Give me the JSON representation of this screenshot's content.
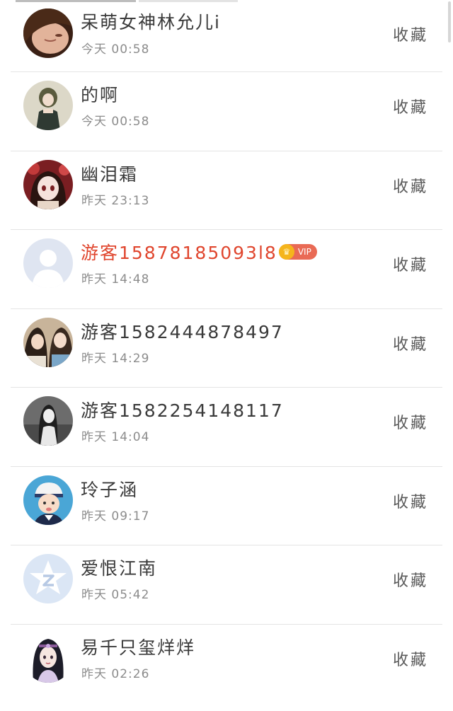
{
  "users": [
    {
      "name": "呆萌女神林允儿i",
      "time": "今天 00:58",
      "vip": false,
      "action": "收藏",
      "avatar_icon": "user-photo-avatar-icon"
    },
    {
      "name": "的啊",
      "time": "今天 00:58",
      "vip": false,
      "action": "收藏",
      "avatar_icon": "user-photo-avatar-icon"
    },
    {
      "name": "幽泪霜",
      "time": "昨天 23:13",
      "vip": false,
      "action": "收藏",
      "avatar_icon": "user-photo-avatar-icon"
    },
    {
      "name": "游客15878185093l8",
      "time": "昨天 14:48",
      "vip": true,
      "vip_label": "VIP",
      "action": "收藏",
      "avatar_icon": "default-user-avatar-icon"
    },
    {
      "name": "游客1582444878497",
      "time": "昨天 14:29",
      "vip": false,
      "action": "收藏",
      "avatar_icon": "user-photo-avatar-icon"
    },
    {
      "name": "游客1582254148117",
      "time": "昨天 14:04",
      "vip": false,
      "action": "收藏",
      "avatar_icon": "user-photo-avatar-icon"
    },
    {
      "name": "玲子涵",
      "time": "昨天 09:17",
      "vip": false,
      "action": "收藏",
      "avatar_icon": "user-photo-avatar-icon"
    },
    {
      "name": "爱恨江南",
      "time": "昨天 05:42",
      "vip": false,
      "action": "收藏",
      "avatar_icon": "qzone-default-avatar-icon"
    },
    {
      "name": "易千只玺烊烊",
      "time": "昨天 02:26",
      "vip": false,
      "action": "收藏",
      "avatar_icon": "user-photo-avatar-icon"
    }
  ],
  "colors": {
    "vip_name": "#e0462e",
    "vip_badge": "#e96a55",
    "crown": "#f5b51c",
    "divider": "#e4e4e4"
  }
}
